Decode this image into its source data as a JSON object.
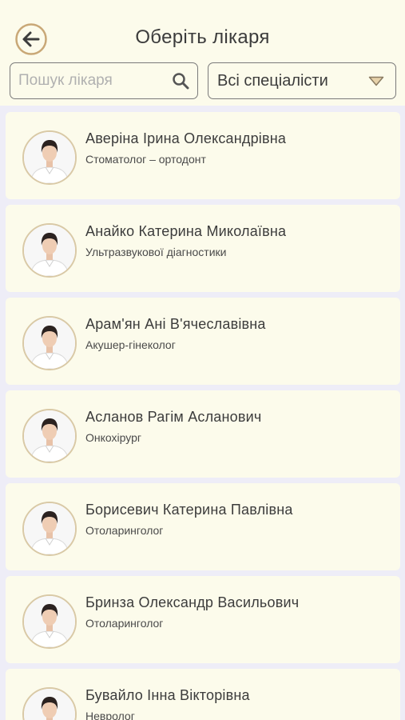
{
  "header": {
    "title": "Оберіть лікаря",
    "back_icon": "arrow-left-circle-icon"
  },
  "search": {
    "placeholder": "Пошук лікаря",
    "value": "",
    "icon": "search-icon"
  },
  "specialty_filter": {
    "selected": "Всі спеціалісти",
    "icon": "triangle-down-icon"
  },
  "colors": {
    "background": "#FCFBEB",
    "list_background": "#EEEDF7",
    "accent": "#C9A877",
    "text": "#3c3c3c"
  },
  "doctors": [
    {
      "name": "Аверіна Ірина Олександрівна",
      "specialty": "Стоматолог – ортодонт"
    },
    {
      "name": "Анайко Катерина Миколаївна",
      "specialty": "Ультразвукової діагностики"
    },
    {
      "name": "Арам'ян Ані В'ячеславівна",
      "specialty": "Акушер-гінеколог"
    },
    {
      "name": "Асланов Рагім Асланович",
      "specialty": "Онкохірург"
    },
    {
      "name": "Борисевич Катерина Павлівна",
      "specialty": "Отоларинголог"
    },
    {
      "name": "Бринза Олександр Васильович",
      "specialty": "Отоларинголог"
    },
    {
      "name": "Бувайло Інна Вікторівна",
      "specialty": "Невролог"
    }
  ]
}
